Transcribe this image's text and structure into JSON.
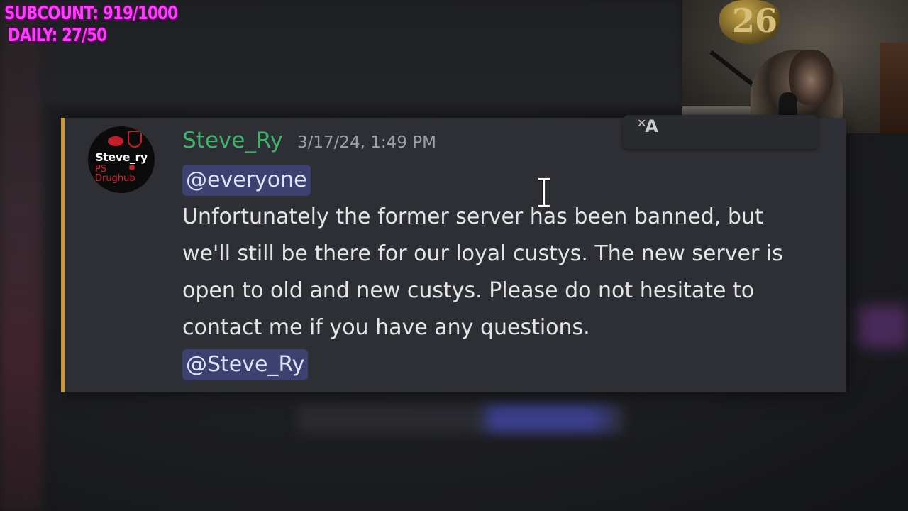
{
  "overlay": {
    "subcount": "SUBCOUNT: 919/1000",
    "daily": "DAILY: 27/50"
  },
  "webcam": {
    "balloon_text": "26"
  },
  "message": {
    "avatar": {
      "name": "Steve_ry",
      "sub_line1": "PS",
      "sub_line2": "Drughub"
    },
    "username": "Steve_Ry",
    "timestamp": "3/17/24, 1:49 PM",
    "mention_top": "@everyone",
    "body": "Unfortunately the former server has been banned, but we'll still be there for our loyal custys. The new server is open to old and new custys. Please do not hesitate to contact me if you have any questions.",
    "mention_bottom": "@Steve_Ry"
  },
  "colors": {
    "username": "#3eb36a",
    "mention_bg": "#3d4170",
    "mention_bar": "#c79a3f",
    "overlay_text": "#ff3cff"
  },
  "icons": {
    "translate": "translate-icon",
    "cursor": "text-cursor-icon"
  }
}
